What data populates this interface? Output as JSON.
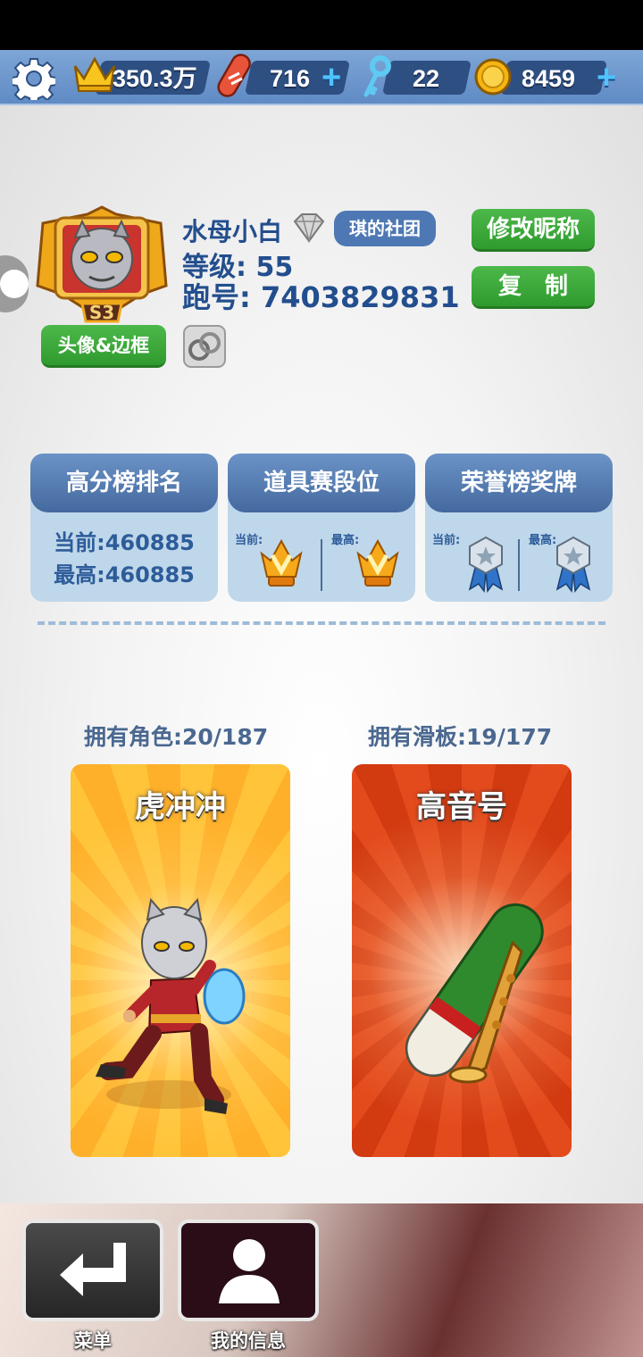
{
  "topbar": {
    "crowns": "350.3万",
    "boards": "716",
    "keys": "22",
    "coins": "8459",
    "plus": "+"
  },
  "profile": {
    "name": "水母小白",
    "club": "琪的社团",
    "level": "等级: 55",
    "run_id": "跑号: 7403829831",
    "badge": "S3",
    "rename_button": "修改昵称",
    "copy_button": "复　制",
    "avatar_frame_button": "头像&边框"
  },
  "cards": [
    {
      "title": "高分榜排名",
      "current": "当前:460885",
      "best": "最高:460885"
    },
    {
      "title": "道具赛段位",
      "current_label": "当前:",
      "best_label": "最高:"
    },
    {
      "title": "荣誉榜奖牌",
      "current_label": "当前:",
      "best_label": "最高:"
    }
  ],
  "owned": {
    "characters_label": "拥有角色:20/187",
    "boards_label": "拥有滑板:19/177",
    "character_name": "虎冲冲",
    "board_name": "高音号"
  },
  "nav": {
    "menu": "菜单",
    "my_info": "我的信息"
  },
  "colors": {
    "accent_blue": "#234e8e",
    "green_button": "#3aa838",
    "topbar": "#6d97cd"
  }
}
